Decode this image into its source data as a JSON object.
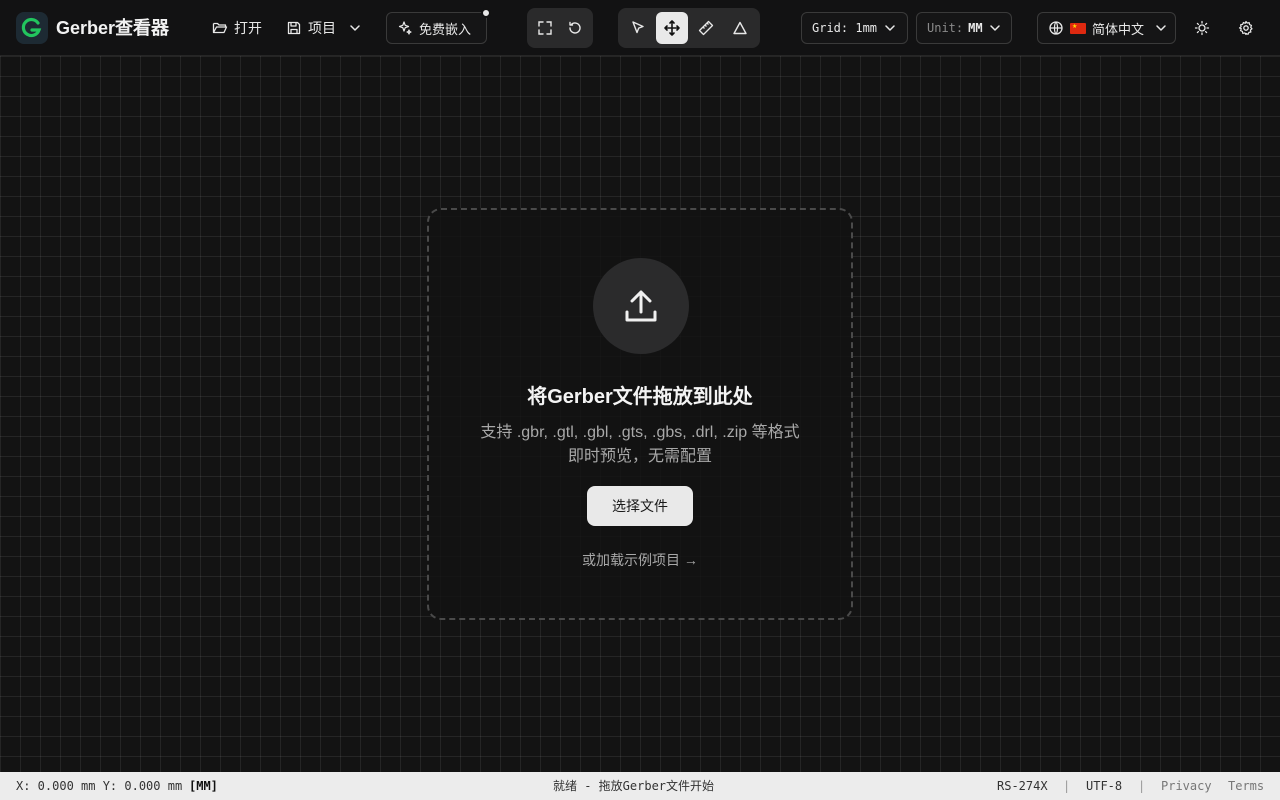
{
  "app": {
    "title": "Gerber查看器",
    "accent": "#22c55e"
  },
  "toolbar": {
    "open_label": "打开",
    "project_label": "项目",
    "embed_label": "免费嵌入",
    "grid_label": "Grid: 1mm",
    "unit_prefix": "Unit:",
    "unit_value": "MM",
    "language_label": "简体中文",
    "language_flag": "🇨🇳",
    "icons": [
      "folder-open-icon",
      "save-icon",
      "sparkles-icon",
      "fullscreen-icon",
      "reset-icon",
      "pointer-icon",
      "move-icon",
      "ruler-icon",
      "triangle-icon",
      "globe-icon",
      "sun-icon",
      "settings-icon"
    ]
  },
  "dropzone": {
    "title": "将Gerber文件拖放到此处",
    "formats": "支持 .gbr, .gtl, .gbl, .gts, .gbs, .drl, .zip 等格式",
    "hint": "即时预览，无需配置",
    "choose_button": "选择文件",
    "example_link": "或加载示例项目 →"
  },
  "status": {
    "coords": "X: 0.000 mm Y: 0.000 mm",
    "unit_tag": "[MM]",
    "message": "就绪 - 拖放Gerber文件开始",
    "format": "RS-274X",
    "sep1": "|",
    "encoding": "UTF-8",
    "sep2": "|",
    "privacy": "Privacy",
    "terms": "Terms"
  }
}
